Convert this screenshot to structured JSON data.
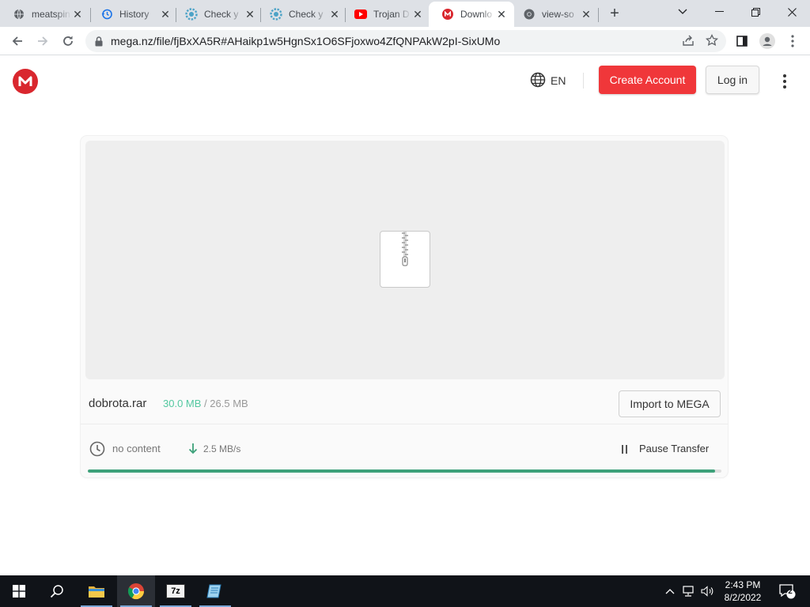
{
  "browser": {
    "tabs": [
      {
        "title": "meatspin",
        "icon": "globe-icon"
      },
      {
        "title": "History",
        "icon": "history-icon"
      },
      {
        "title": "Check y",
        "icon": "gear-icon"
      },
      {
        "title": "Check y",
        "icon": "gear-icon"
      },
      {
        "title": "Trojan D",
        "icon": "youtube-icon"
      },
      {
        "title": "Downlo",
        "icon": "mega-icon"
      },
      {
        "title": "view-so",
        "icon": "chrome-icon"
      }
    ],
    "active_tab": 5,
    "new_tab_label": "+",
    "url": "mega.nz/file/fjBxXA5R#AHaikp1w5HgnSx1O6SFjoxwo4ZfQNPAkW2pI-SixUMo"
  },
  "header": {
    "logo_letter": "M",
    "language": "EN",
    "create_account": "Create Account",
    "login": "Log in"
  },
  "file": {
    "name": "dobrota.rar",
    "downloaded": "30.0 MB",
    "separator": "/",
    "total": "26.5 MB",
    "import_label": "Import to MEGA",
    "time_status": "no content",
    "speed": "2.5 MB/s",
    "pause_label": "Pause Transfer",
    "progress_fraction": 0.99
  },
  "taskbar": {
    "apps": [
      "file-explorer-icon",
      "chrome-icon",
      "7zip-icon",
      "notepad-icon"
    ],
    "seven_zip_label": "7z",
    "time": "2:43 PM",
    "date": "8/2/2022",
    "notification_count": "2"
  },
  "colors": {
    "mega_red": "#d9272e",
    "create_button": "#f0373a",
    "progress": "#3da17a",
    "downloaded_text": "#53c8a0"
  }
}
